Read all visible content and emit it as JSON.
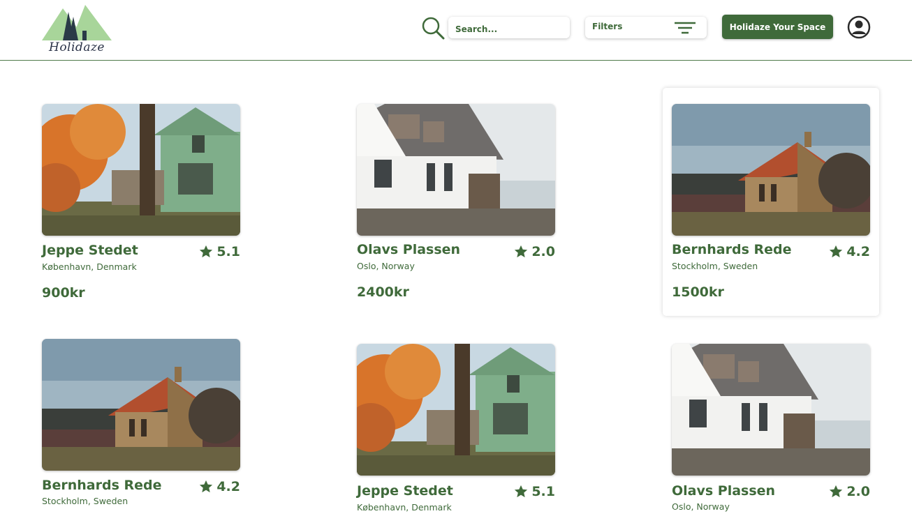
{
  "brand": {
    "name": "Holidaze"
  },
  "header": {
    "search_placeholder": "Search...",
    "filters_label": "Filters",
    "cta_label": "Holidaze Your Space"
  },
  "colors": {
    "brand_green": "#3f6a3a",
    "logo_green": "#a8d59a"
  },
  "listings": [
    {
      "title": "Jeppe Stedet",
      "location": "København, Denmark",
      "rating": "5.1",
      "price": "900kr",
      "photo": "green-house-autumn"
    },
    {
      "title": "Olavs Plassen",
      "location": "Oslo, Norway",
      "rating": "2.0",
      "price": "2400kr",
      "photo": "white-house-sea"
    },
    {
      "title": "Bernhards Rede",
      "location": "Stockholm, Sweden",
      "rating": "4.2",
      "price": "1500kr",
      "photo": "stone-cottage"
    },
    {
      "title": "Bernhards Rede",
      "location": "Stockholm, Sweden",
      "rating": "4.2",
      "photo": "stone-cottage"
    },
    {
      "title": "Jeppe Stedet",
      "location": "København, Denmark",
      "rating": "5.1",
      "photo": "green-house-autumn"
    },
    {
      "title": "Olavs Plassen",
      "location": "Oslo, Norway",
      "rating": "2.0",
      "photo": "white-house-sea"
    }
  ]
}
